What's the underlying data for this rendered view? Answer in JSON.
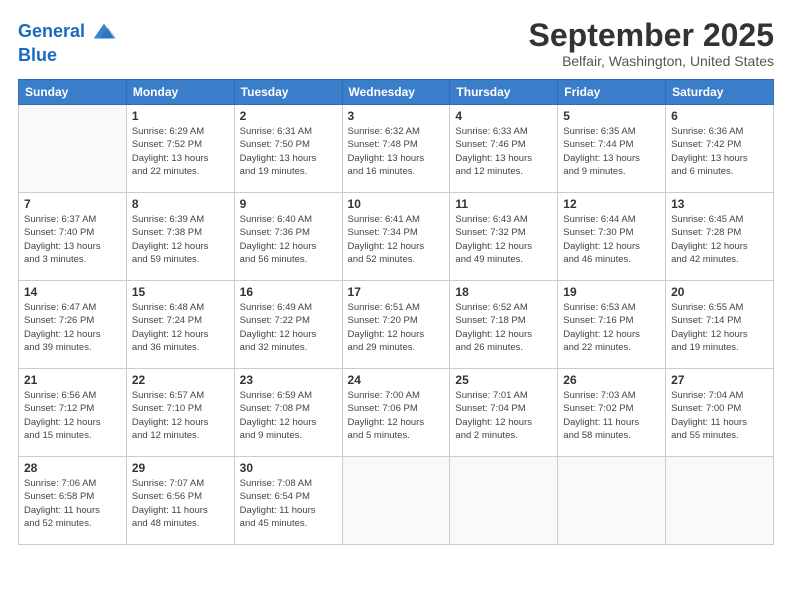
{
  "header": {
    "logo_line1": "General",
    "logo_line2": "Blue",
    "month": "September 2025",
    "location": "Belfair, Washington, United States"
  },
  "weekdays": [
    "Sunday",
    "Monday",
    "Tuesday",
    "Wednesday",
    "Thursday",
    "Friday",
    "Saturday"
  ],
  "weeks": [
    [
      {
        "day": "",
        "info": ""
      },
      {
        "day": "1",
        "info": "Sunrise: 6:29 AM\nSunset: 7:52 PM\nDaylight: 13 hours\nand 22 minutes."
      },
      {
        "day": "2",
        "info": "Sunrise: 6:31 AM\nSunset: 7:50 PM\nDaylight: 13 hours\nand 19 minutes."
      },
      {
        "day": "3",
        "info": "Sunrise: 6:32 AM\nSunset: 7:48 PM\nDaylight: 13 hours\nand 16 minutes."
      },
      {
        "day": "4",
        "info": "Sunrise: 6:33 AM\nSunset: 7:46 PM\nDaylight: 13 hours\nand 12 minutes."
      },
      {
        "day": "5",
        "info": "Sunrise: 6:35 AM\nSunset: 7:44 PM\nDaylight: 13 hours\nand 9 minutes."
      },
      {
        "day": "6",
        "info": "Sunrise: 6:36 AM\nSunset: 7:42 PM\nDaylight: 13 hours\nand 6 minutes."
      }
    ],
    [
      {
        "day": "7",
        "info": "Sunrise: 6:37 AM\nSunset: 7:40 PM\nDaylight: 13 hours\nand 3 minutes."
      },
      {
        "day": "8",
        "info": "Sunrise: 6:39 AM\nSunset: 7:38 PM\nDaylight: 12 hours\nand 59 minutes."
      },
      {
        "day": "9",
        "info": "Sunrise: 6:40 AM\nSunset: 7:36 PM\nDaylight: 12 hours\nand 56 minutes."
      },
      {
        "day": "10",
        "info": "Sunrise: 6:41 AM\nSunset: 7:34 PM\nDaylight: 12 hours\nand 52 minutes."
      },
      {
        "day": "11",
        "info": "Sunrise: 6:43 AM\nSunset: 7:32 PM\nDaylight: 12 hours\nand 49 minutes."
      },
      {
        "day": "12",
        "info": "Sunrise: 6:44 AM\nSunset: 7:30 PM\nDaylight: 12 hours\nand 46 minutes."
      },
      {
        "day": "13",
        "info": "Sunrise: 6:45 AM\nSunset: 7:28 PM\nDaylight: 12 hours\nand 42 minutes."
      }
    ],
    [
      {
        "day": "14",
        "info": "Sunrise: 6:47 AM\nSunset: 7:26 PM\nDaylight: 12 hours\nand 39 minutes."
      },
      {
        "day": "15",
        "info": "Sunrise: 6:48 AM\nSunset: 7:24 PM\nDaylight: 12 hours\nand 36 minutes."
      },
      {
        "day": "16",
        "info": "Sunrise: 6:49 AM\nSunset: 7:22 PM\nDaylight: 12 hours\nand 32 minutes."
      },
      {
        "day": "17",
        "info": "Sunrise: 6:51 AM\nSunset: 7:20 PM\nDaylight: 12 hours\nand 29 minutes."
      },
      {
        "day": "18",
        "info": "Sunrise: 6:52 AM\nSunset: 7:18 PM\nDaylight: 12 hours\nand 26 minutes."
      },
      {
        "day": "19",
        "info": "Sunrise: 6:53 AM\nSunset: 7:16 PM\nDaylight: 12 hours\nand 22 minutes."
      },
      {
        "day": "20",
        "info": "Sunrise: 6:55 AM\nSunset: 7:14 PM\nDaylight: 12 hours\nand 19 minutes."
      }
    ],
    [
      {
        "day": "21",
        "info": "Sunrise: 6:56 AM\nSunset: 7:12 PM\nDaylight: 12 hours\nand 15 minutes."
      },
      {
        "day": "22",
        "info": "Sunrise: 6:57 AM\nSunset: 7:10 PM\nDaylight: 12 hours\nand 12 minutes."
      },
      {
        "day": "23",
        "info": "Sunrise: 6:59 AM\nSunset: 7:08 PM\nDaylight: 12 hours\nand 9 minutes."
      },
      {
        "day": "24",
        "info": "Sunrise: 7:00 AM\nSunset: 7:06 PM\nDaylight: 12 hours\nand 5 minutes."
      },
      {
        "day": "25",
        "info": "Sunrise: 7:01 AM\nSunset: 7:04 PM\nDaylight: 12 hours\nand 2 minutes."
      },
      {
        "day": "26",
        "info": "Sunrise: 7:03 AM\nSunset: 7:02 PM\nDaylight: 11 hours\nand 58 minutes."
      },
      {
        "day": "27",
        "info": "Sunrise: 7:04 AM\nSunset: 7:00 PM\nDaylight: 11 hours\nand 55 minutes."
      }
    ],
    [
      {
        "day": "28",
        "info": "Sunrise: 7:06 AM\nSunset: 6:58 PM\nDaylight: 11 hours\nand 52 minutes."
      },
      {
        "day": "29",
        "info": "Sunrise: 7:07 AM\nSunset: 6:56 PM\nDaylight: 11 hours\nand 48 minutes."
      },
      {
        "day": "30",
        "info": "Sunrise: 7:08 AM\nSunset: 6:54 PM\nDaylight: 11 hours\nand 45 minutes."
      },
      {
        "day": "",
        "info": ""
      },
      {
        "day": "",
        "info": ""
      },
      {
        "day": "",
        "info": ""
      },
      {
        "day": "",
        "info": ""
      }
    ]
  ]
}
